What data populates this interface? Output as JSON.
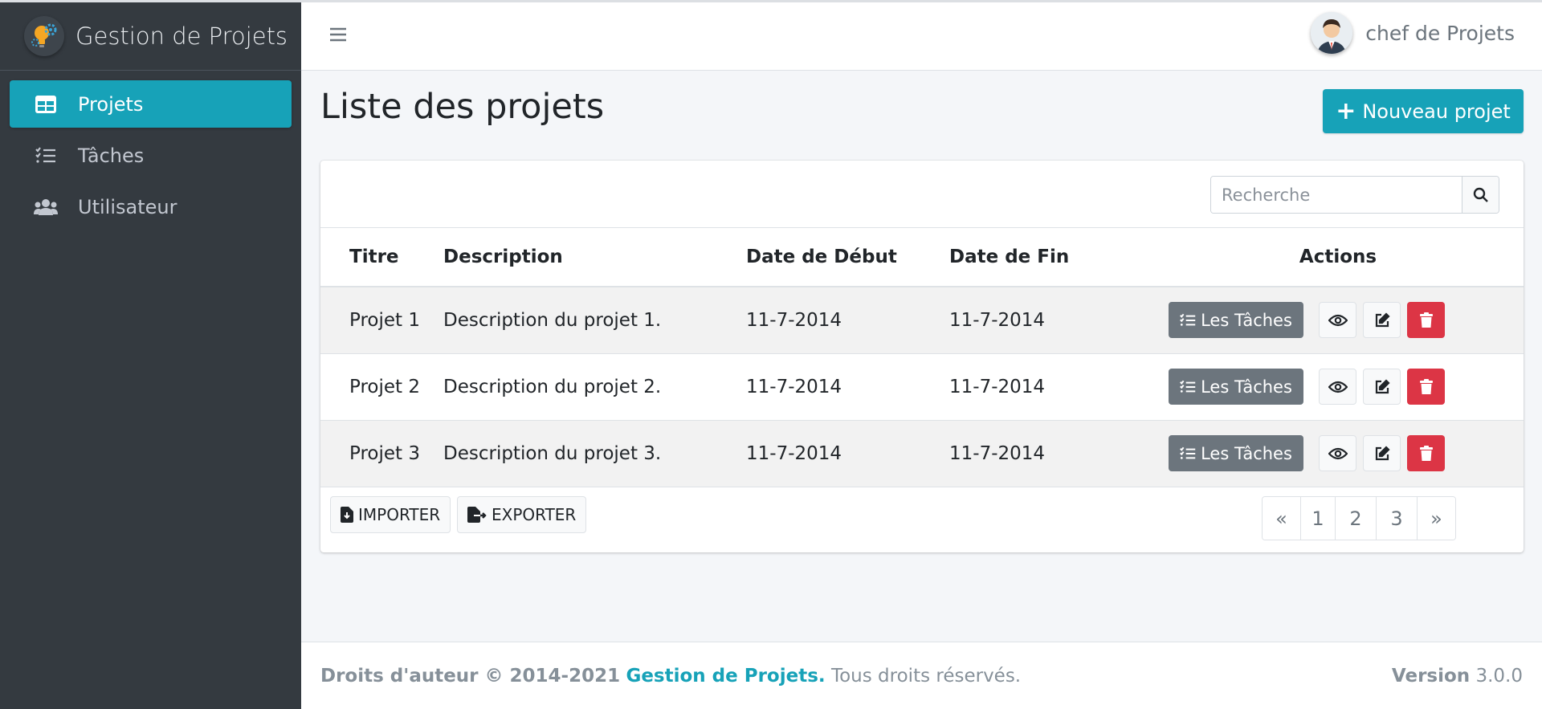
{
  "brand": {
    "name": "Gestion de Projets"
  },
  "sidebar": {
    "items": [
      {
        "label": "Projets",
        "icon": "table-icon",
        "active": true
      },
      {
        "label": "Tâches",
        "icon": "tasks-icon",
        "active": false
      },
      {
        "label": "Utilisateur",
        "icon": "users-icon",
        "active": false
      }
    ]
  },
  "header": {
    "user_name": "chef de Projets"
  },
  "page": {
    "title": "Liste des projets",
    "new_button": "Nouveau projet",
    "new_button_icon": "+"
  },
  "search": {
    "placeholder": "Recherche"
  },
  "table": {
    "columns": [
      "Titre",
      "Description",
      "Date de Début",
      "Date de Fin",
      "Actions"
    ],
    "rows": [
      {
        "title": "Projet 1",
        "description": "Description du projet 1.",
        "start": "11-7-2014",
        "end": "11-7-2014"
      },
      {
        "title": "Projet 2",
        "description": "Description du projet 2.",
        "start": "11-7-2014",
        "end": "11-7-2014"
      },
      {
        "title": "Projet 3",
        "description": "Description du projet 3.",
        "start": "11-7-2014",
        "end": "11-7-2014"
      }
    ],
    "tasks_button": "Les Tâches"
  },
  "footer_actions": {
    "import": "IMPORTER",
    "export": "EXPORTER"
  },
  "pagination": {
    "prev": "«",
    "pages": [
      "1",
      "2",
      "3"
    ],
    "next": "»"
  },
  "footer": {
    "copyright": "Droits d'auteur © 2014-2021",
    "brand_link": "Gestion de Projets.",
    "rights": "Tous droits réservés.",
    "version_label": "Version",
    "version": "3.0.0"
  },
  "colors": {
    "accent": "#17a2b8",
    "sidebar_bg": "#343a40",
    "danger": "#dc3545",
    "secondary": "#6c757d"
  }
}
